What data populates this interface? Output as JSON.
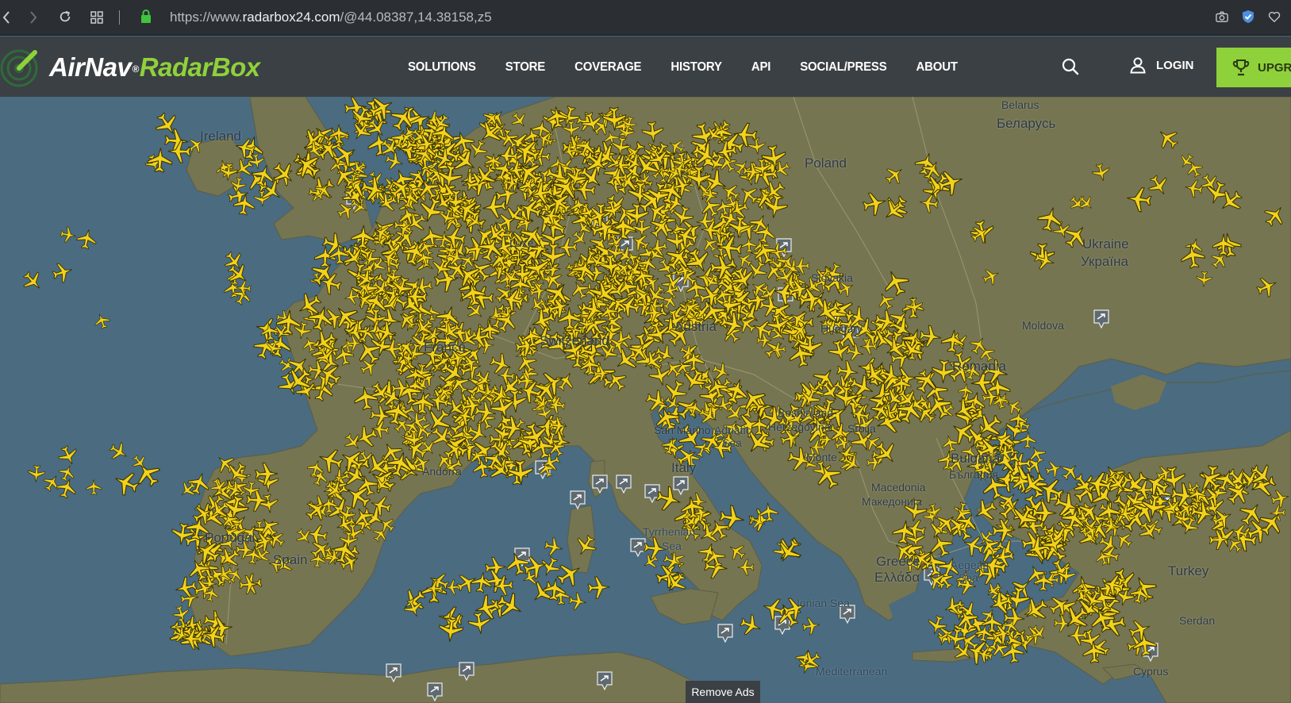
{
  "browser": {
    "url_prefix": "https://www.",
    "url_host": "radarbox24.com",
    "url_path": "/@44.08387,14.38158,z5"
  },
  "brand": {
    "part1": "AirNav",
    "part2": "RadarBox",
    "accent_color": "#8fd13a",
    "header_bg": "#3b4044"
  },
  "nav": {
    "items": [
      "SOLUTIONS",
      "STORE",
      "COVERAGE",
      "HISTORY",
      "API",
      "SOCIAL/PRESS",
      "ABOUT"
    ],
    "login_label": "LOGIN",
    "upgrade_label": "UPGRA"
  },
  "icons": {
    "back": "chevron-left-icon",
    "forward": "chevron-right-icon",
    "reload": "reload-icon",
    "apps": "grid-icon",
    "secure": "lock-icon",
    "camera": "camera-icon",
    "shield": "shield-check-icon",
    "heart": "heart-icon",
    "search": "search-icon",
    "user": "user-icon",
    "trophy": "trophy-icon",
    "aircraft": "airplane-icon",
    "airport": "airport-marker-icon"
  },
  "map": {
    "plane_color": "#f2d21b",
    "labels": {
      "ireland": "Ireland",
      "belarus_en": "Belarus",
      "belarus_local": "Беларусь",
      "poland": "Poland",
      "ukraine_en": "Ukraine",
      "ukraine_local": "Україна",
      "luxe": "Luxe",
      "slovakia": "Slovakia",
      "moldova": "Moldova",
      "hungary": "Hungary",
      "austria": "Austria",
      "switzerland": "Switzerland",
      "france": "France",
      "romania": "Romania",
      "bosnia_1": "Bosnia and",
      "bosnia_2": "Herzegovina",
      "srbija": "Srbija",
      "san_marino": "San Marino",
      "adriatic_1": "Adriatic",
      "adriatic_2": "Sea",
      "montenegro": "Monte",
      "bulgaria_en": "Bulgaria",
      "bulgaria_local": "България",
      "andorra": "Andorra",
      "italy": "Italy",
      "macedonia_1": "Macedonia",
      "macedonia_2": "Македонија",
      "portugal": "Portugal",
      "tyrrhenian_1": "Tyrrhenian",
      "tyrrhenian_2": "Sea",
      "spain": "Spain",
      "greece_1": "Greece",
      "greece_2": "Ελλάδα",
      "aegean_1": "Aegean",
      "aegean_2": "Sea",
      "turkey": "Turkey",
      "ionian": "Ionian Sea",
      "mediterranean": "Mediterranean",
      "cyprus": "Cyprus",
      "serdan": "Serdan"
    }
  },
  "ads": {
    "remove_label": "Remove Ads"
  }
}
